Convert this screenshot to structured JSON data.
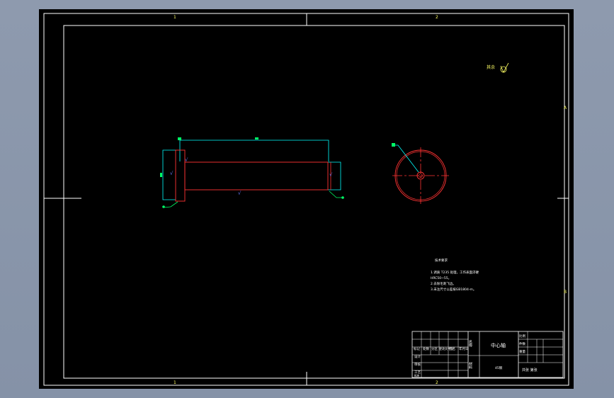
{
  "drawing": {
    "zone_marks": {
      "top": [
        "1",
        "2"
      ],
      "bottom": [
        "1",
        "2"
      ],
      "right": [
        "A",
        "B"
      ]
    },
    "roughness_note": "其余",
    "tech_notes": [
      "技术要求",
      "1.调质 T235 处理，工作表面淬硬",
      "HRC50~55。",
      "2.去除毛刺飞边。",
      "3.未注尺寸公差按GB1804-m。"
    ],
    "title_block": {
      "part_name": "中心轴",
      "name_label": "名称",
      "material_label": "材料",
      "material": "45钢",
      "scale_label": "比例",
      "quantity_label": "件数",
      "weight_label": "重量",
      "sheet_label": "共张 第张",
      "left_labels": [
        "标记",
        "处数",
        "分区",
        "更改文件号",
        "签名",
        "年月日"
      ],
      "role_labels": [
        "设计",
        "审核",
        "工艺",
        "批准"
      ]
    },
    "colors": {
      "frame": "#ffffff",
      "part": "#ff3333",
      "dimension": "#00ffff",
      "text": "#ffff66",
      "leader": "#00ff66"
    }
  }
}
